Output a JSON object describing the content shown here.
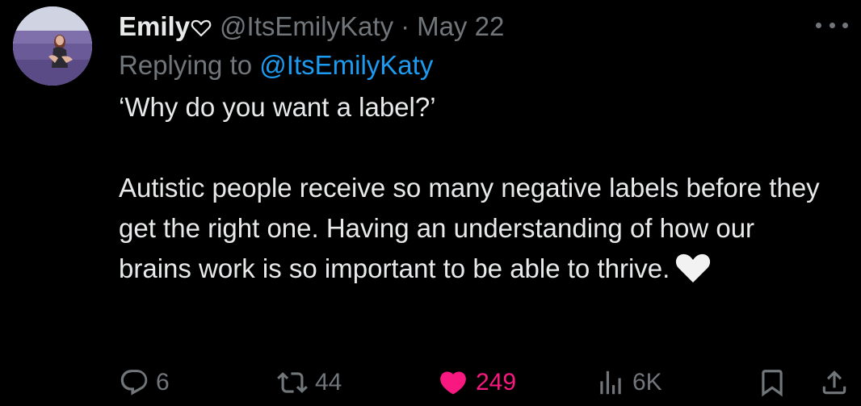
{
  "author": {
    "display_name": "Emily",
    "handle": "@ItsEmilyKaty",
    "separator": "·",
    "date": "May 22"
  },
  "reply": {
    "prefix": "Replying to",
    "handle": "@ItsEmilyKaty"
  },
  "body": {
    "line1": "‘Why do you want a label?’",
    "paragraph2": "Autistic people receive so many negative labels before they get the right one. Having an understanding of how our brains work is so important to be able to thrive."
  },
  "actions": {
    "replies": "6",
    "retweets": "44",
    "likes": "249",
    "views": "6K"
  },
  "colors": {
    "background": "#000000",
    "text": "#e7e9ea",
    "muted": "#71767b",
    "link": "#1d9bf0",
    "like": "#f91880"
  },
  "icons": [
    "heart-outline-icon",
    "white-heart-icon",
    "more-icon",
    "reply-icon",
    "retweet-icon",
    "like-icon",
    "views-icon",
    "bookmark-icon",
    "share-icon"
  ]
}
